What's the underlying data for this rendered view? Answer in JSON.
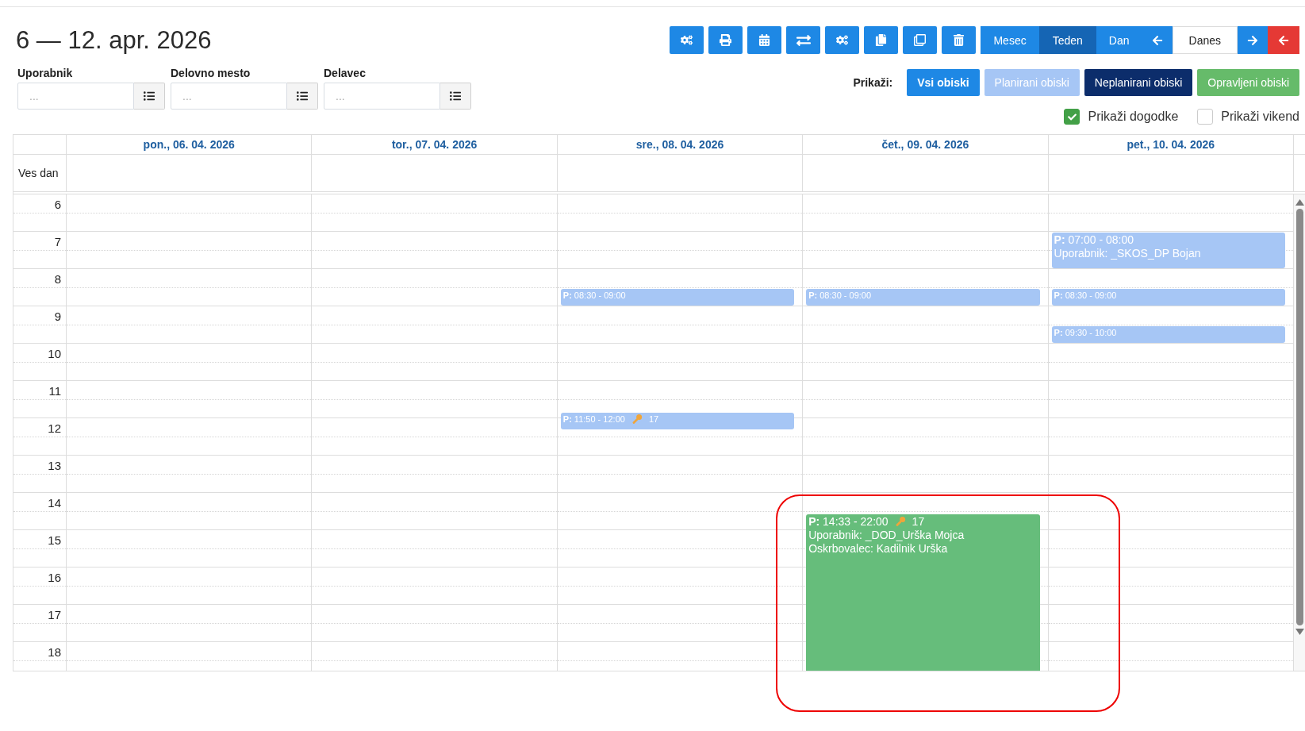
{
  "title": "6 — 12. apr. 2026",
  "views": [
    {
      "label": "Mesec",
      "selected": false
    },
    {
      "label": "Teden",
      "selected": true
    },
    {
      "label": "Dan",
      "selected": false
    }
  ],
  "today_button": "Danes",
  "filters": [
    {
      "label": "Uporabnik",
      "placeholder": "..."
    },
    {
      "label": "Delovno mesto",
      "placeholder": "..."
    },
    {
      "label": "Delavec",
      "placeholder": "..."
    }
  ],
  "show_label": "Prikaži:",
  "visit_filters": [
    {
      "label": "Vsi obiski",
      "color": "#1e88e5",
      "selected": true
    },
    {
      "label": "Planirani obiski",
      "color": "#a6c6f5",
      "selected": false
    },
    {
      "label": "Neplanirani obiski",
      "color": "#0c2d6b",
      "selected": false
    },
    {
      "label": "Opravljeni obiski",
      "color": "#66bb6a",
      "selected": false
    }
  ],
  "checkboxes": [
    {
      "label": "Prikaži dogodke",
      "checked": true
    },
    {
      "label": "Prikaži vikend",
      "checked": false
    }
  ],
  "calendar": {
    "all_day_label": "Ves dan",
    "hours": [
      "6",
      "7",
      "8",
      "9",
      "10",
      "11",
      "12",
      "13",
      "14",
      "15",
      "16",
      "17",
      "18"
    ],
    "days": [
      {
        "label": "pon., 06. 04. 2026"
      },
      {
        "label": "tor., 07. 04. 2026"
      },
      {
        "label": "sre., 08. 04. 2026",
        "events": [
          {
            "title": "**P:** 08:30 - 09:00",
            "color": "#a6c6f5",
            "highlighted": false
          },
          {
            "title": "**P:** 11:50 - 12:00",
            "badge": "17",
            "color": "#a6c6f5",
            "highlighted": false
          }
        ]
      },
      {
        "label": "čet., 09. 04. 2026",
        "events": [
          {
            "title": "**P:** 08:30 - 09:00",
            "color": "#a6c6f5",
            "highlighted": false
          },
          {
            "title": "**P:** 14:33 - 22:00",
            "badge": "17",
            "lines": [
              "Uporabnik: _DOD_Urška Mojca",
              "Oskrbovalec: Kadilnik Urška"
            ],
            "color": "#66bd7b",
            "highlighted": true
          }
        ]
      },
      {
        "label": "pet., 10. 04. 2026",
        "events": [
          {
            "title": "**P:** 07:00 - 08:00",
            "lines": [
              "Uporabnik: _SKOS_DP Bojan"
            ],
            "color": "#a6c6f5",
            "highlighted": false
          },
          {
            "title": "**P:** 08:30 - 09:00",
            "color": "#a6c6f5",
            "highlighted": false
          },
          {
            "title": "**P:** 09:30 - 10:00",
            "color": "#a6c6f5",
            "highlighted": false
          }
        ]
      }
    ]
  }
}
